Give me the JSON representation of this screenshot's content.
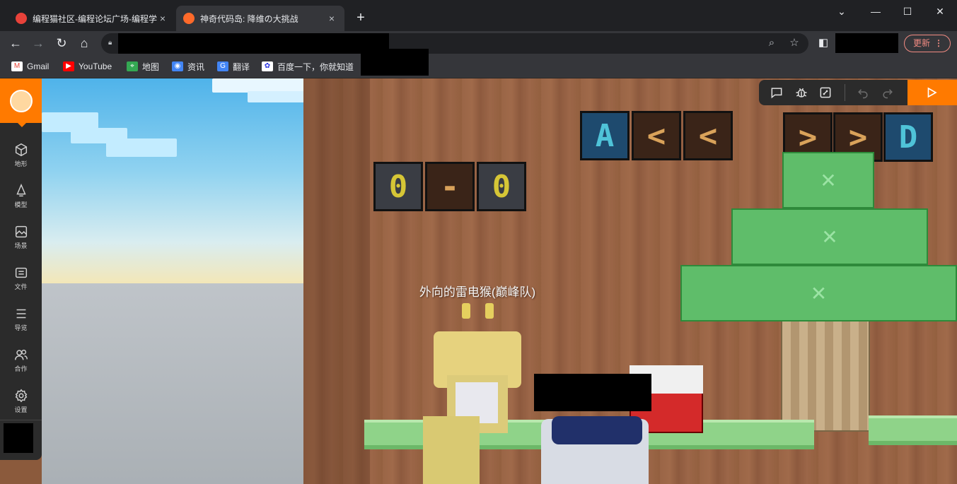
{
  "browser": {
    "tabs": [
      {
        "title": "编程猫社区-编程论坛广场-编程学",
        "close": "×",
        "active": false
      },
      {
        "title": "神奇代码岛: 降维の大挑战",
        "close": "×",
        "active": true
      }
    ],
    "new_tab": "+",
    "window_controls": {
      "dropdown": "⌄",
      "minimize": "—",
      "maximize": "☐",
      "close": "✕"
    },
    "update_label": "更新",
    "update_menu": "⋮"
  },
  "bookmarks": [
    {
      "label": "Gmail",
      "icon": "gmail-icon",
      "color": "#ea4335"
    },
    {
      "label": "YouTube",
      "icon": "youtube-icon",
      "color": "#ff0000"
    },
    {
      "label": "地图",
      "icon": "maps-icon",
      "color": "#34a853"
    },
    {
      "label": "资讯",
      "icon": "news-icon",
      "color": "#4285f4"
    },
    {
      "label": "翻译",
      "icon": "translate-icon",
      "color": "#4285f4"
    },
    {
      "label": "百度一下，你就知道",
      "icon": "baidu-icon",
      "color": "#2932e1"
    }
  ],
  "sidebar": {
    "items": [
      {
        "label": "地形",
        "icon": "cube-icon"
      },
      {
        "label": "模型",
        "icon": "bell-icon"
      },
      {
        "label": "场景",
        "icon": "image-icon"
      },
      {
        "label": "文件",
        "icon": "file-icon"
      },
      {
        "label": "导览",
        "icon": "list-icon"
      },
      {
        "label": "合作",
        "icon": "people-icon"
      },
      {
        "label": "设置",
        "icon": "gear-icon"
      }
    ]
  },
  "scene": {
    "player_name": "外向的雷电猴(巅峰队)",
    "sign_left": [
      "0",
      "-",
      "0"
    ],
    "sign_center": [
      "A",
      "<",
      "<"
    ],
    "sign_right": [
      ">",
      ">",
      "D"
    ]
  },
  "colors": {
    "accent": "#ff7a00",
    "sidebar_bg": "#2b2b2b",
    "sign_yellow": "#d6c636",
    "sign_blue_text": "#4fc3d8",
    "sign_brown_text": "#d9a25a"
  }
}
